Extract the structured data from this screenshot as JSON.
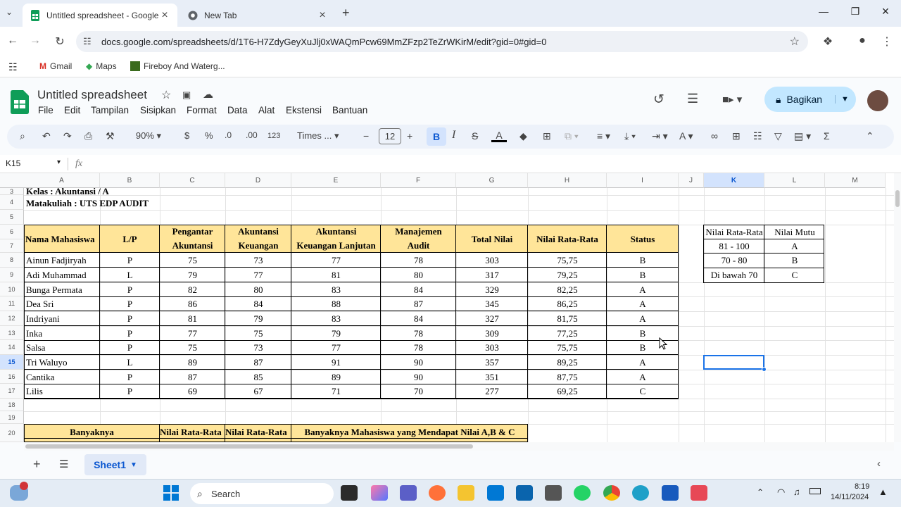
{
  "browser": {
    "tabs": [
      {
        "title": "Untitled spreadsheet - Google S",
        "active": true
      },
      {
        "title": "New Tab",
        "active": false
      }
    ],
    "url": "docs.google.com/spreadsheets/d/1T6-H7ZdyGeyXuJlj0xWAQmPcw69MmZFzp2TeZrWKirM/edit?gid=0#gid=0",
    "bookmarks": [
      "Gmail",
      "Maps",
      "Fireboy And Waterg..."
    ]
  },
  "sheets": {
    "title": "Untitled spreadsheet",
    "menu": [
      "File",
      "Edit",
      "Tampilan",
      "Sisipkan",
      "Format",
      "Data",
      "Alat",
      "Ekstensi",
      "Bantuan"
    ],
    "share_label": "Bagikan",
    "toolbar": {
      "zoom": "90%",
      "currency": "$",
      "percent": "%",
      "dec_minus": ".0",
      "dec_plus": ".00",
      "number_fmt": "123",
      "font": "Times ...",
      "font_size": "12",
      "bold": "B",
      "italic": "I"
    },
    "name_box": "K15",
    "fx": "fx",
    "sheet_tab": "Sheet1"
  },
  "grid": {
    "columns": [
      "A",
      "B",
      "C",
      "D",
      "E",
      "F",
      "G",
      "H",
      "I",
      "J",
      "K",
      "L",
      "M"
    ],
    "rows": [
      "3",
      "4",
      "5",
      "6",
      "7",
      "8",
      "9",
      "10",
      "11",
      "12",
      "13",
      "14",
      "15",
      "16",
      "17",
      "18",
      "19",
      "20"
    ],
    "kelas": "Kelas            : Akuntansi / A",
    "matakuliah": "Matakuliah  : UTS EDP AUDIT",
    "headers": {
      "nama": "Nama Mahasiswa",
      "lp": "L/P",
      "pa1": "Pengantar",
      "pa2": "Akuntansi",
      "ak1": "Akuntansi",
      "ak2": "Keuangan",
      "akl1": "Akuntansi",
      "akl2": "Keuangan Lanjutan",
      "ma1": "Manajemen",
      "ma2": "Audit",
      "total": "Total Nilai",
      "rata": "Nilai Rata-Rata",
      "status": "Status"
    },
    "students": [
      [
        "Ainun Fadjiryah",
        "P",
        "75",
        "73",
        "77",
        "78",
        "303",
        "75,75",
        "B"
      ],
      [
        "Adi Muhammad",
        "L",
        "79",
        "77",
        "81",
        "80",
        "317",
        "79,25",
        "B"
      ],
      [
        "Bunga Permata",
        "P",
        "82",
        "80",
        "83",
        "84",
        "329",
        "82,25",
        "A"
      ],
      [
        "Dea Sri",
        "P",
        "86",
        "84",
        "88",
        "87",
        "345",
        "86,25",
        "A"
      ],
      [
        "Indriyani",
        "P",
        "81",
        "79",
        "83",
        "84",
        "327",
        "81,75",
        "A"
      ],
      [
        "Inka",
        "P",
        "77",
        "75",
        "79",
        "78",
        "309",
        "77,25",
        "B"
      ],
      [
        "Salsa",
        "P",
        "75",
        "73",
        "77",
        "78",
        "303",
        "75,75",
        "B"
      ],
      [
        "Tri Waluyo",
        "L",
        "89",
        "87",
        "91",
        "90",
        "357",
        "89,25",
        "A"
      ],
      [
        "Cantika",
        "P",
        "87",
        "85",
        "89",
        "90",
        "351",
        "87,75",
        "A"
      ],
      [
        "Lilis",
        "P",
        "69",
        "67",
        "71",
        "70",
        "277",
        "69,25",
        "C"
      ]
    ],
    "lookup": {
      "h1": "Nilai Rata-Rata",
      "h2": "Nilai Mutu",
      "rows": [
        [
          "81 - 100",
          "A"
        ],
        [
          "70 - 80",
          "B"
        ],
        [
          "Di bawah 70",
          "C"
        ]
      ]
    },
    "row20": {
      "banyaknya": "Banyaknya",
      "rata1": "Nilai Rata-Rata",
      "rata2": "Nilai Rata-Rata",
      "mahasiswa": "Banyaknya Mahasiswa yang Mendapat Nilai A,B & C"
    }
  },
  "taskbar": {
    "search": "Search",
    "time": "8:19",
    "date": "14/11/2024"
  }
}
